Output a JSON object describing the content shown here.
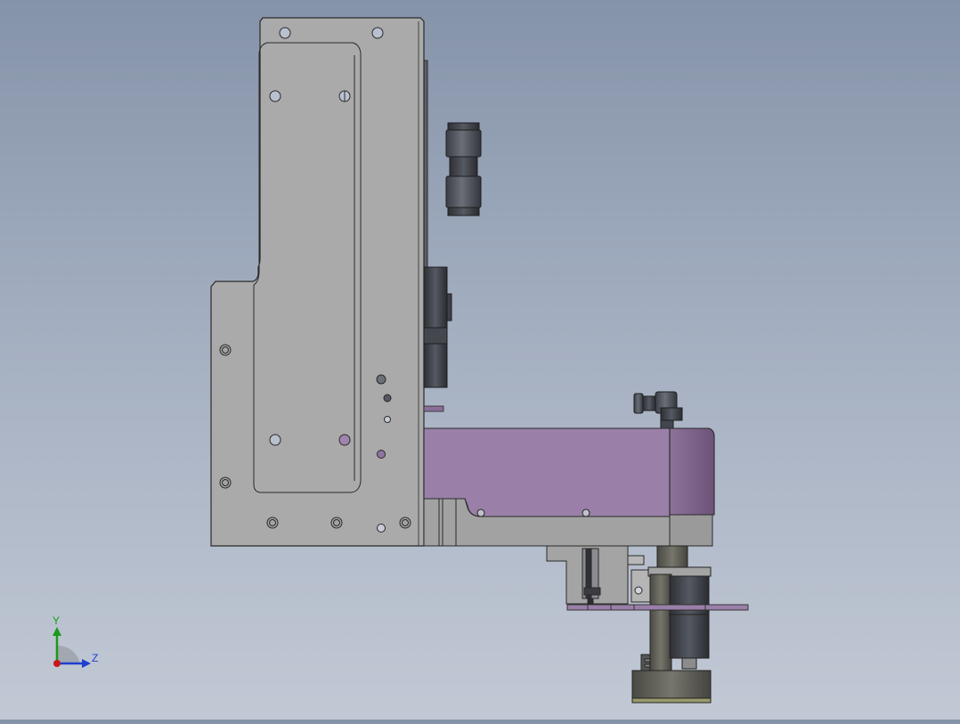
{
  "triad": {
    "y_label": "Y",
    "z_label": "Z"
  },
  "colors": {
    "background_top": "#8593a9",
    "background_bottom": "#c2c9d5",
    "plate_gray": "#a9a9a9",
    "purple_arm": "#9a80a8",
    "dark_fitting": "#4f525a",
    "edge": "#2a2a2a"
  }
}
